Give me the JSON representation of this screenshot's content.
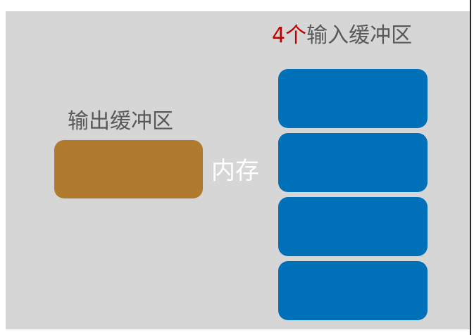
{
  "input_buffers": {
    "title_count": "4个",
    "title_text": "输入缓冲区",
    "count": 4,
    "color": "#0070b8"
  },
  "output_buffer": {
    "title": "输出缓冲区",
    "color": "#b07a2f"
  },
  "memory": {
    "label": "内存"
  },
  "colors": {
    "background": "#d6d6d6",
    "title_text": "#595959",
    "count_highlight": "#c00000",
    "memory_text": "#ffffff"
  }
}
